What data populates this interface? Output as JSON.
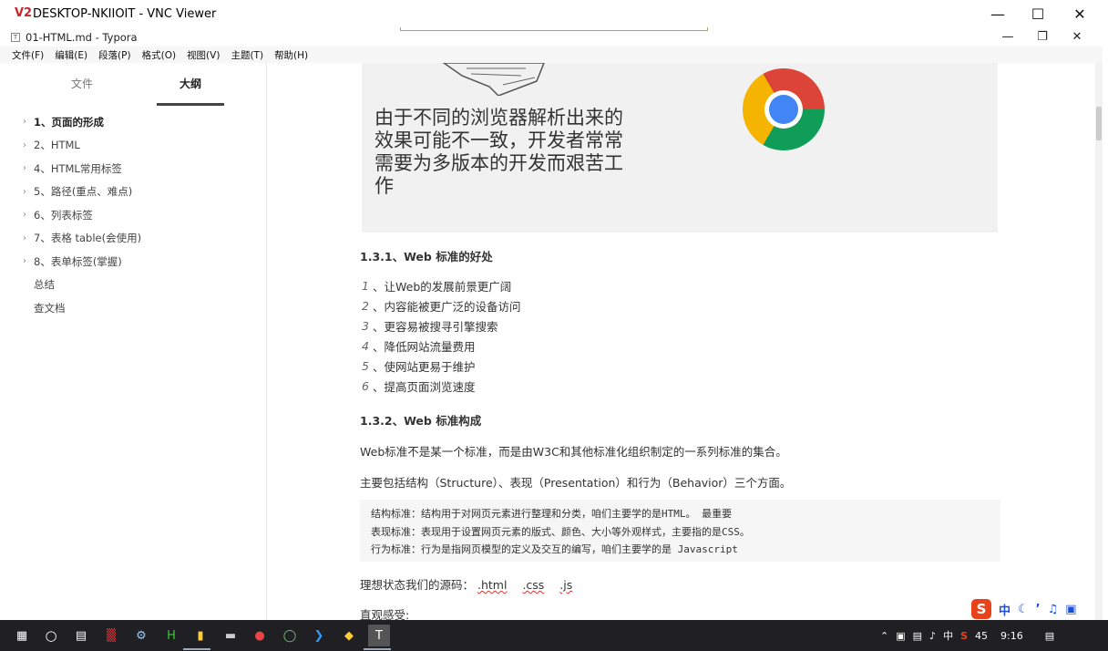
{
  "vnc": {
    "title": "DESKTOP-NKIIOIT - VNC Viewer",
    "logo": "V2"
  },
  "window": {
    "title": "01-HTML.md - Typora"
  },
  "menu": [
    "文件(F)",
    "编辑(E)",
    "段落(P)",
    "格式(O)",
    "视图(V)",
    "主题(T)",
    "帮助(H)"
  ],
  "sidebar": {
    "tabs": [
      "文件",
      "大纲"
    ],
    "active_tab": "大纲",
    "outline": [
      {
        "label": "1、页面的形成",
        "arrow": true,
        "bold": true
      },
      {
        "label": "2、HTML",
        "arrow": true
      },
      {
        "label": "4、HTML常用标签",
        "arrow": true
      },
      {
        "label": "5、路径(重点、难点)",
        "arrow": true
      },
      {
        "label": "6、列表标签",
        "arrow": true
      },
      {
        "label": "7、表格 table(会使用)",
        "arrow": true
      },
      {
        "label": "8、表单标签(掌握)",
        "arrow": true
      },
      {
        "label": "总结",
        "arrow": false
      },
      {
        "label": "查文档",
        "arrow": false
      }
    ],
    "footer": {
      "left": "<",
      "right": "</>"
    }
  },
  "document": {
    "hero_text": "由于不同的浏览器解析出来的效果可能不一致，开发者常常需要为多版本的开发而艰苦工作",
    "h_131": "1.3.1、Web 标准的好处",
    "benefits": [
      {
        "num": "1",
        "text": "、让Web的发展前景更广阔"
      },
      {
        "num": "2",
        "text": "、内容能被更广泛的设备访问"
      },
      {
        "num": "3",
        "text": "、更容易被搜寻引擎搜索"
      },
      {
        "num": "4",
        "text": "、降低网站流量费用"
      },
      {
        "num": "5",
        "text": "、使网站更易于维护"
      },
      {
        "num": "6",
        "text": "、提高页面浏览速度"
      }
    ],
    "h_132": "1.3.2、Web 标准构成",
    "p1": "Web标准不是某一个标准，而是由W3C和其他标准化组织制定的一系列标准的集合。",
    "p2": "主要包括结构（Structure）、表现（Presentation）和行为（Behavior）三个方面。",
    "code": [
      "结构标准：结构用于对网页元素进行整理和分类，咱们主要学的是HTML。 最重要",
      "表现标准：表现用于设置网页元素的版式、颜色、大小等外观样式，主要指的是CSS。",
      "行为标准：行为是指网页模型的定义及交互的编写，咱们主要学的是 Javascript"
    ],
    "p3_label": "理想状态我们的源码：",
    "p3_exts": [
      ".html",
      ".css",
      ".js"
    ],
    "p4": "直观感受:"
  },
  "ime": {
    "logo": "S",
    "mode": "中"
  },
  "tray": {
    "ime_lang": "中",
    "number": "45",
    "time": "9:16"
  },
  "colors": {
    "accent_red": "#d0202a",
    "taskbar": "#1f1f24",
    "code_bg": "#f6f6f6"
  }
}
